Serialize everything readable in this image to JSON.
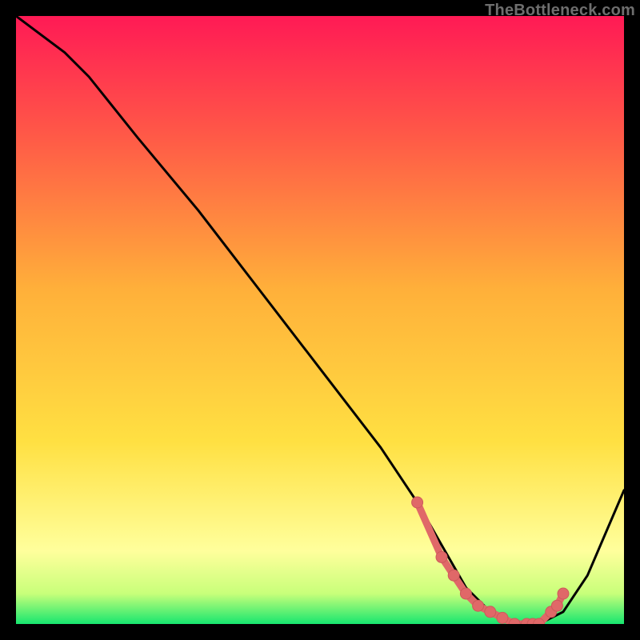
{
  "watermark": "TheBottleneck.com",
  "colors": {
    "bg_black": "#000000",
    "grad_top": "#ff1a55",
    "grad_mid1": "#ff7a3a",
    "grad_mid2": "#ffe042",
    "grad_pale": "#ffff9c",
    "grad_bottom": "#17e66f",
    "curve": "#000000",
    "marker_fill": "#e06868",
    "marker_stroke": "#cc5a5a"
  },
  "chart_data": {
    "type": "line",
    "title": "",
    "xlabel": "",
    "ylabel": "",
    "xlim": [
      0,
      100
    ],
    "ylim": [
      0,
      100
    ],
    "grid": false,
    "legend_position": "none",
    "series": [
      {
        "name": "bottleneck-curve",
        "x": [
          0,
          4,
          8,
          12,
          20,
          30,
          40,
          50,
          60,
          66,
          70,
          74,
          78,
          82,
          86,
          90,
          94,
          100
        ],
        "y": [
          100,
          97,
          94,
          90,
          80,
          68,
          55,
          42,
          29,
          20,
          13,
          6,
          2,
          0,
          0,
          2,
          8,
          22
        ]
      }
    ],
    "markers": {
      "name": "optimal-range",
      "x": [
        66,
        70,
        72,
        74,
        76,
        78,
        80,
        82,
        84,
        85,
        86,
        88,
        89,
        90
      ],
      "y": [
        20,
        11,
        8,
        5,
        3,
        2,
        1,
        0,
        0,
        0,
        0,
        2,
        3,
        5
      ]
    }
  }
}
